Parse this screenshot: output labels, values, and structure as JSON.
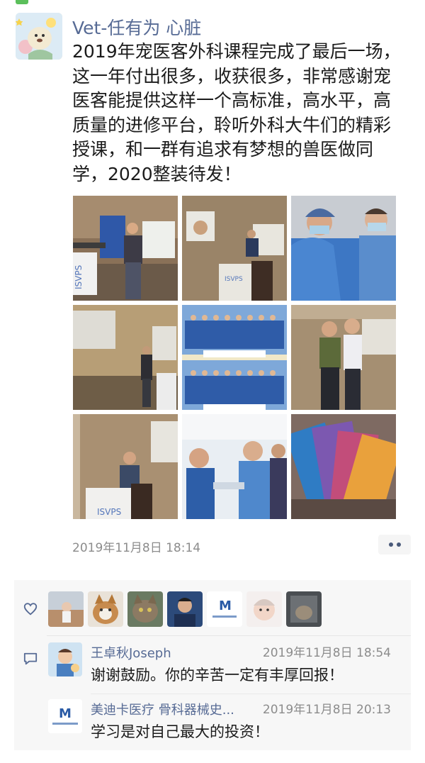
{
  "post": {
    "username": "Vet-任有为 心脏",
    "lines": [
      "2019年宠医客外科课程完成了最后一场，",
      "这一年付出很多，收获很多，非常感谢宠",
      "医客能提供这样一个高标准，高水平，高",
      "质量的进修平台，聆听外科大牛们的精彩",
      "授课，和一群有追求有梦想的兽医做同",
      "学，2020整装待发！"
    ],
    "timestamp": "2019年11月8日 18:14",
    "photos": [
      "lecture-speaker-photo",
      "lecture-slides-photo",
      "surgery-team-photo",
      "classroom-projection-photo",
      "group-photo-collage",
      "two-speakers-photo",
      "speaker-at-podium-photo",
      "surgical-training-photo",
      "course-cards-photo"
    ],
    "photo_logo_text": "ISVPS"
  },
  "likes": {
    "icon": "heart-icon",
    "count_avatars": 7
  },
  "comments": [
    {
      "name": "王卓秋Joseph",
      "time": "2019年11月8日 18:54",
      "text": "谢谢鼓励。你的辛苦一定有丰厚回报！"
    },
    {
      "name": "美迪卡医疗 骨科器械史...",
      "time": "2019年11月8日 20:13",
      "text": "学习是对自己最大的投资！"
    }
  ],
  "brand_logo_text": "M"
}
